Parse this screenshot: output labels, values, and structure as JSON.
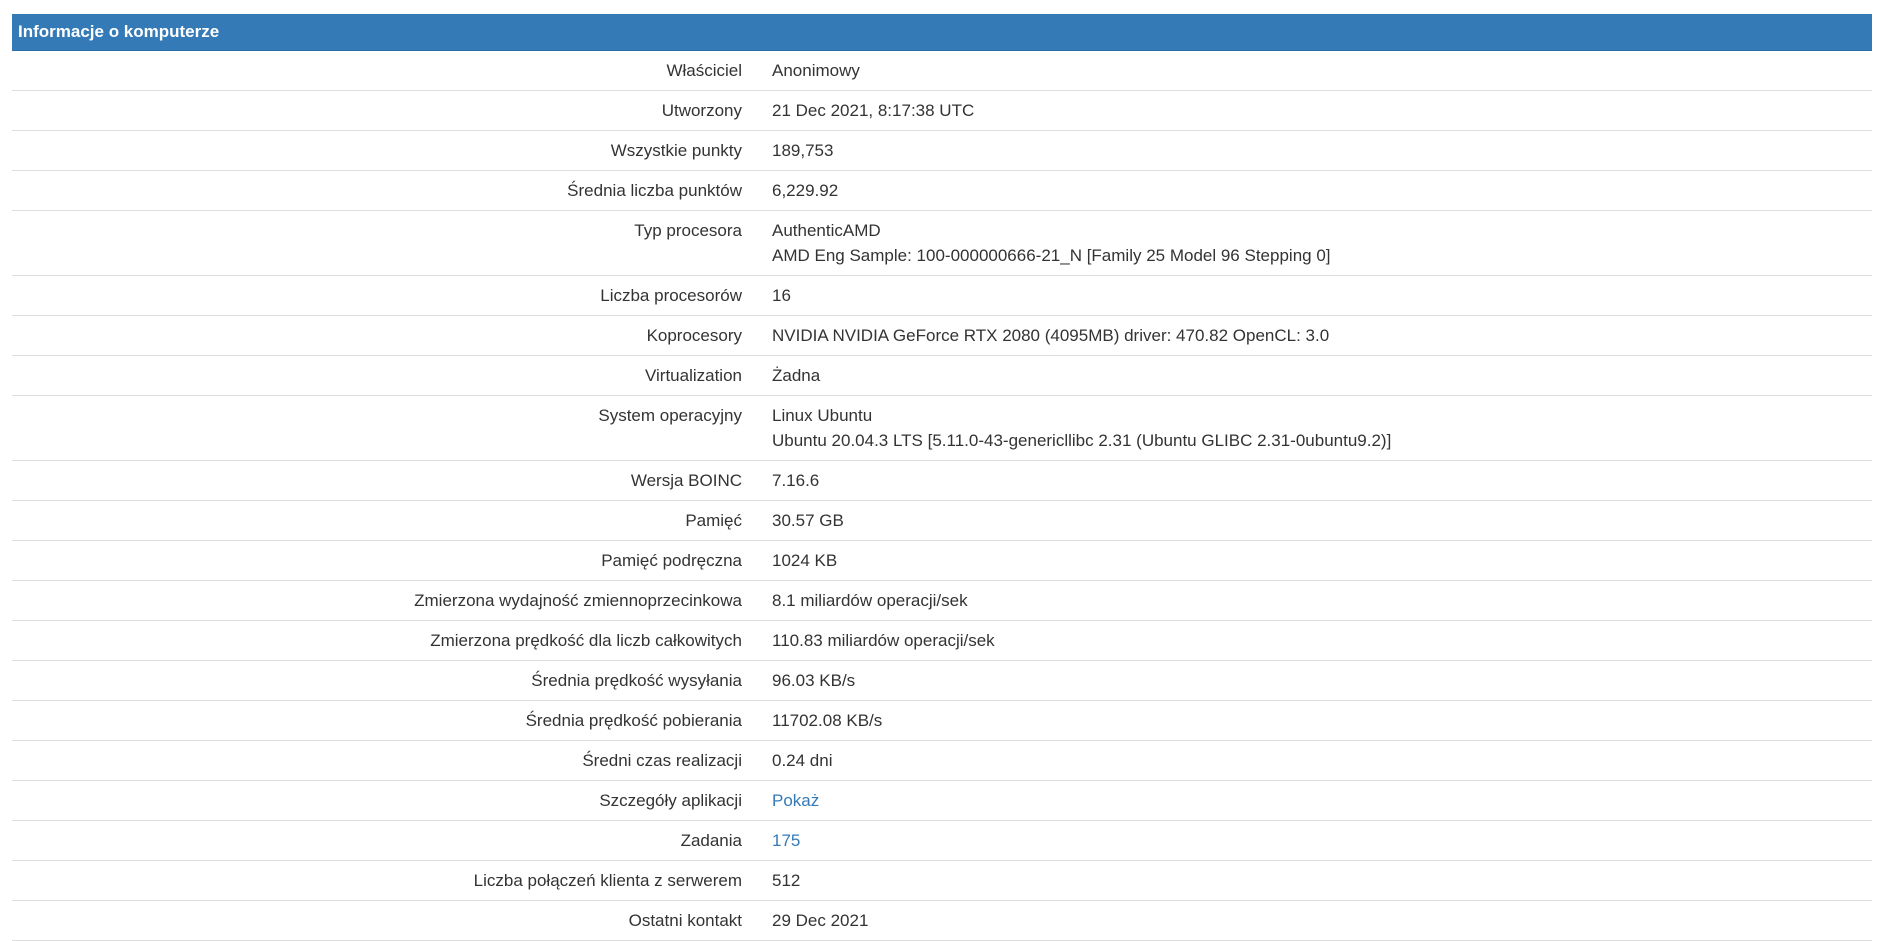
{
  "panel": {
    "title": "Informacje o komputerze"
  },
  "rows": [
    {
      "label": "Właściciel",
      "value": "Anonimowy"
    },
    {
      "label": "Utworzony",
      "value": "21 Dec 2021, 8:17:38 UTC"
    },
    {
      "label": "Wszystkie punkty",
      "value": "189,753"
    },
    {
      "label": "Średnia liczba punktów",
      "value": "6,229.92"
    },
    {
      "label": "Typ procesora",
      "value": "AuthenticAMD",
      "value2": "AMD Eng Sample: 100-000000666-21_N [Family 25 Model 96 Stepping 0]"
    },
    {
      "label": "Liczba procesorów",
      "value": "16"
    },
    {
      "label": "Koprocesory",
      "value": "NVIDIA NVIDIA GeForce RTX 2080 (4095MB) driver: 470.82 OpenCL: 3.0"
    },
    {
      "label": "Virtualization",
      "value": "Żadna"
    },
    {
      "label": "System operacyjny",
      "value": "Linux Ubuntu",
      "value2": "Ubuntu 20.04.3 LTS [5.11.0-43-genericllibc 2.31 (Ubuntu GLIBC 2.31-0ubuntu9.2)]"
    },
    {
      "label": "Wersja BOINC",
      "value": "7.16.6"
    },
    {
      "label": "Pamięć",
      "value": "30.57 GB"
    },
    {
      "label": "Pamięć podręczna",
      "value": "1024 KB"
    },
    {
      "label": "Zmierzona wydajność zmiennoprzecinkowa",
      "value": "8.1 miliardów operacji/sek"
    },
    {
      "label": "Zmierzona prędkość dla liczb całkowitych",
      "value": "110.83 miliardów operacji/sek"
    },
    {
      "label": "Średnia prędkość wysyłania",
      "value": "96.03 KB/s"
    },
    {
      "label": "Średnia prędkość pobierania",
      "value": "11702.08 KB/s"
    },
    {
      "label": "Średni czas realizacji",
      "value": "0.24 dni"
    },
    {
      "label": "Szczegóły aplikacji",
      "value": "Pokaż"
    },
    {
      "label": "Zadania",
      "value": "175"
    },
    {
      "label": "Liczba połączeń klienta z serwerem",
      "value": "512"
    },
    {
      "label": "Ostatni kontakt",
      "value": "29 Dec 2021"
    }
  ],
  "colors": {
    "header_bg": "#337ab7",
    "link": "#337ab7",
    "text": "#333333",
    "divider": "#dddddd"
  }
}
